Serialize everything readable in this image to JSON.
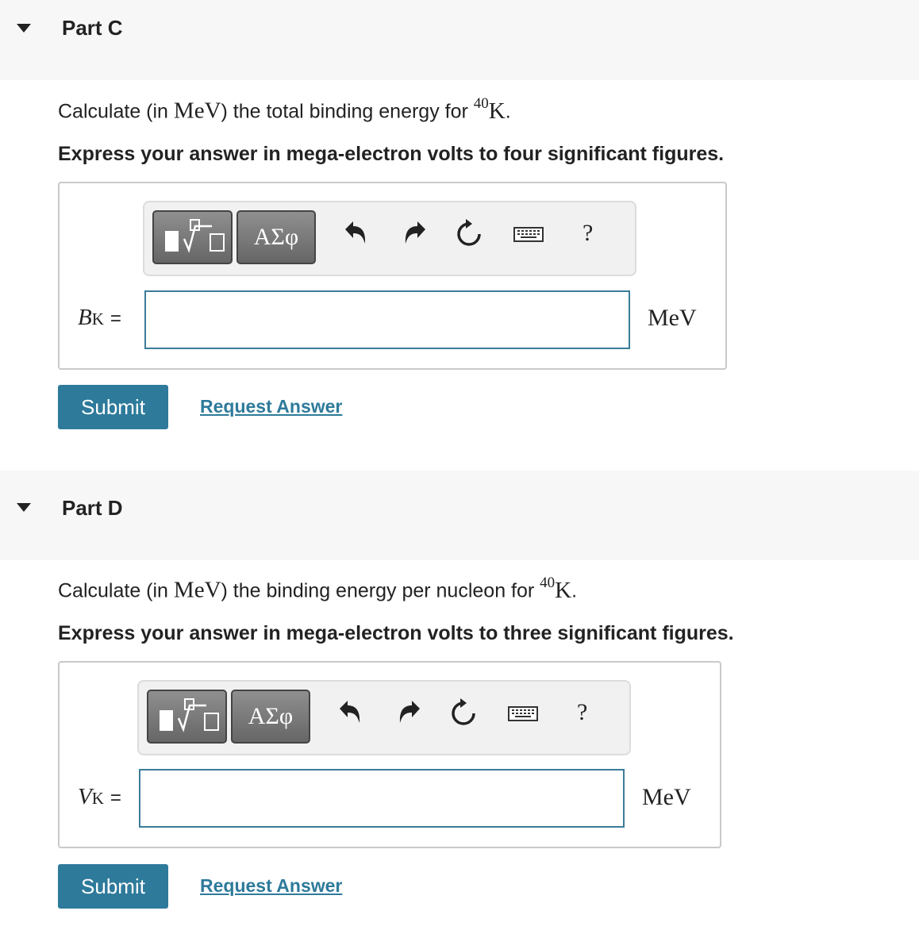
{
  "partC": {
    "title": "Part C",
    "question_prefix": "Calculate (in ",
    "question_unit": "MeV",
    "question_mid": ") the total binding energy for ",
    "isotope_mass": "40",
    "isotope_symbol": "K",
    "question_end": ".",
    "instruction": "Express your answer in mega-electron volts to four significant figures.",
    "toolbar": {
      "greek_label": "ΑΣφ",
      "help_label": "?"
    },
    "variable": "B",
    "variable_sub": "K",
    "equals": "=",
    "input_value": "",
    "unit": "MeV",
    "submit_label": "Submit",
    "request_label": "Request Answer"
  },
  "partD": {
    "title": "Part D",
    "question_prefix": "Calculate (in ",
    "question_unit": "MeV",
    "question_mid": ") the binding energy per nucleon for ",
    "isotope_mass": "40",
    "isotope_symbol": "K",
    "question_end": ".",
    "instruction": "Express your answer in mega-electron volts to three significant figures.",
    "toolbar": {
      "greek_label": "ΑΣφ",
      "help_label": "?"
    },
    "variable": "V",
    "variable_sub": "K",
    "equals": "=",
    "input_value": "",
    "unit": "MeV",
    "submit_label": "Submit",
    "request_label": "Request Answer"
  },
  "icons": [
    "caret-down-icon",
    "template-icon",
    "undo-icon",
    "redo-icon",
    "reset-icon",
    "keyboard-icon",
    "help-icon"
  ]
}
